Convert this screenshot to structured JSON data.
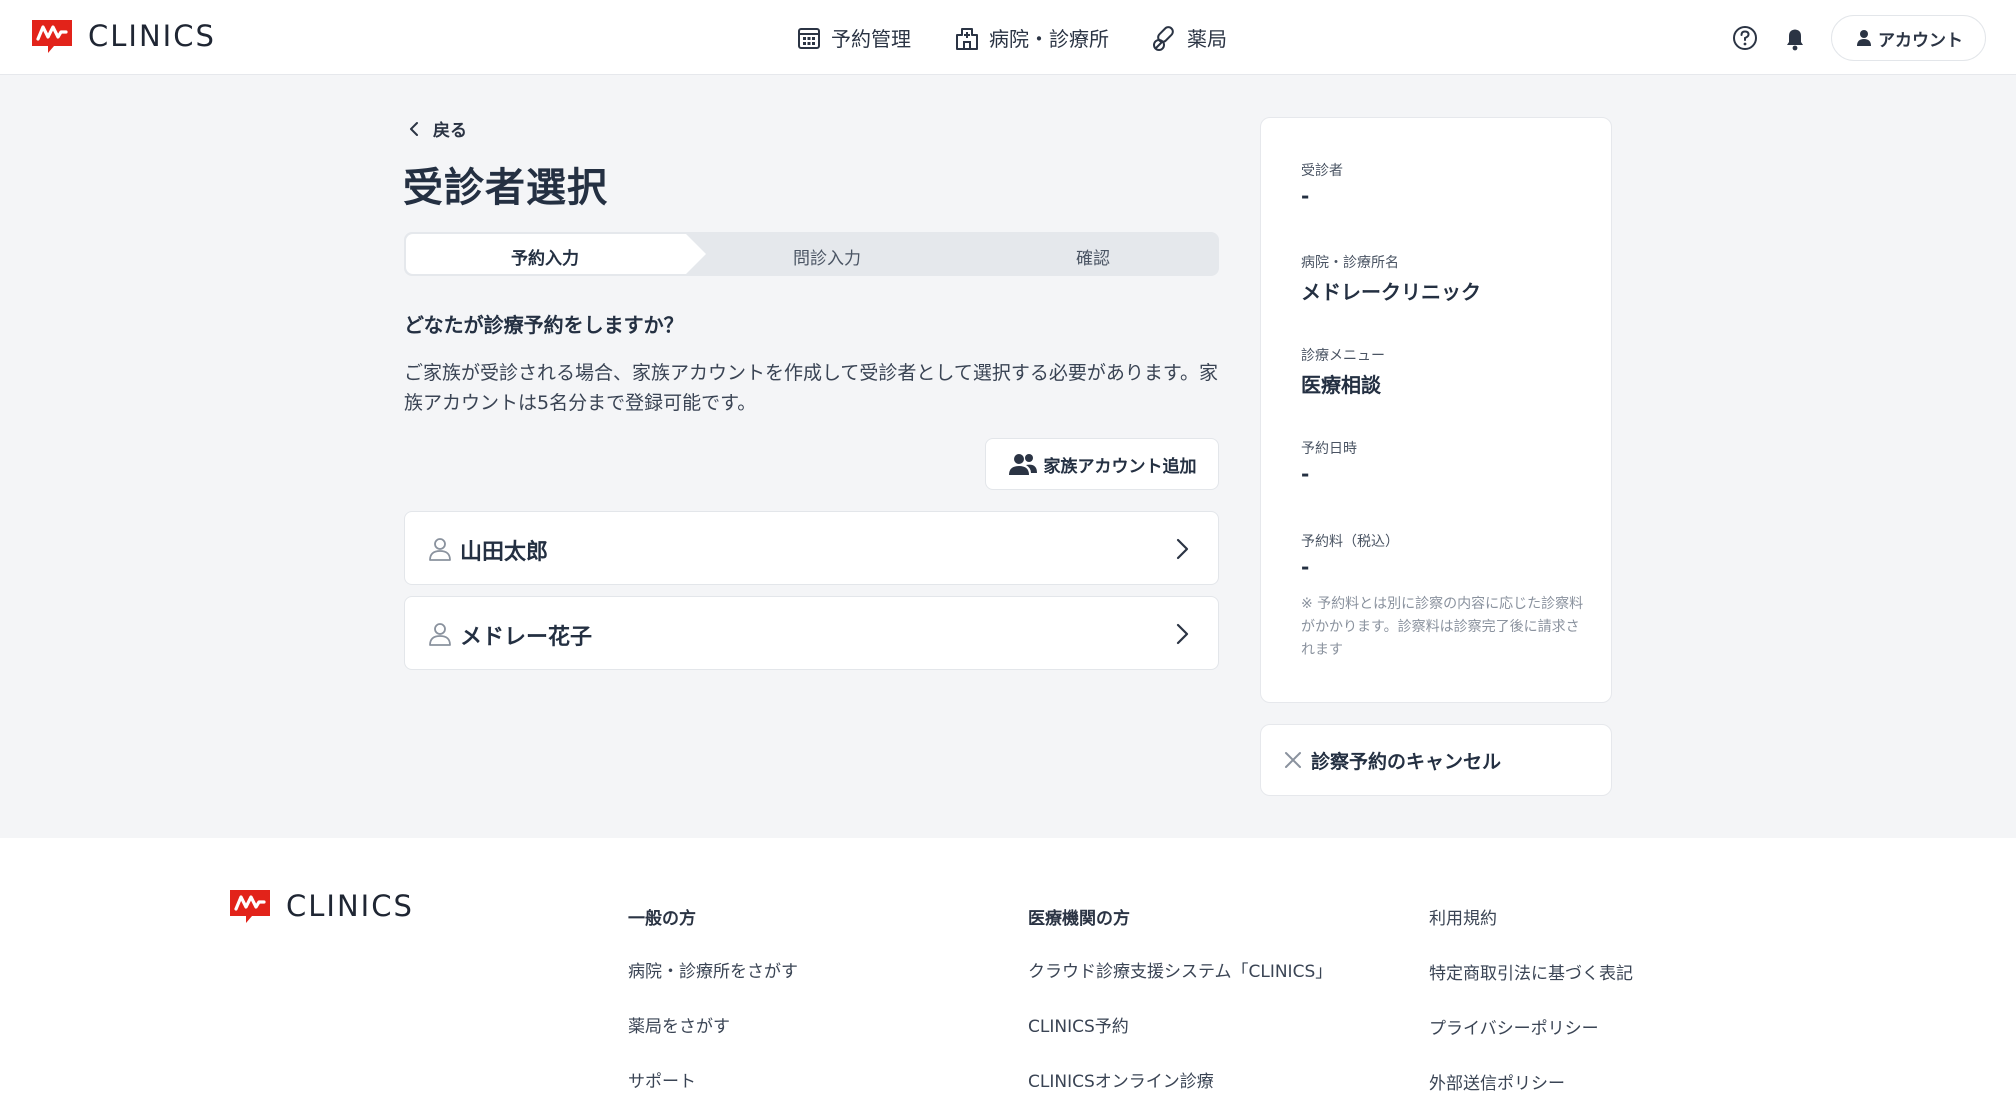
{
  "header": {
    "brand": "CLINICS",
    "nav": [
      {
        "label": "予約管理",
        "icon": "calendar-icon"
      },
      {
        "label": "病院・診療所",
        "icon": "hospital-icon"
      },
      {
        "label": "薬局",
        "icon": "pill-icon"
      }
    ],
    "account_label": "アカウント"
  },
  "main": {
    "back_label": "戻る",
    "title": "受診者選択",
    "steps": [
      "予約入力",
      "問診入力",
      "確認"
    ],
    "question": "どなたが診療予約をしますか？",
    "description": "ご家族が受診される場合、家族アカウントを作成して受診者として選択する必要があります。家族アカウントは5名分まで登録可能です。",
    "add_family_label": "家族アカウント追加",
    "patients": [
      {
        "name": "山田太郎"
      },
      {
        "name": "メドレー花子"
      }
    ]
  },
  "summary": {
    "patient_label": "受診者",
    "patient_value": "-",
    "clinic_label": "病院・診療所名",
    "clinic_value": "メドレークリニック",
    "menu_label": "診療メニュー",
    "menu_value": "医療相談",
    "datetime_label": "予約日時",
    "datetime_value": "-",
    "fee_label": "予約料（税込）",
    "fee_value": "-",
    "note": "※ 予約料とは別に診察の内容に応じた診察料がかかります。診察料は診察完了後に請求されます",
    "cancel_label": "診察予約のキャンセル"
  },
  "footer": {
    "brand": "CLINICS",
    "general_title": "一般の方",
    "general_links": [
      "病院・診療所をさがす",
      "薬局をさがす",
      "サポート"
    ],
    "medical_title": "医療機関の方",
    "medical_links": [
      "クラウド診療支援システム「CLINICS」",
      "CLINICS予約",
      "CLINICSオンライン診療"
    ],
    "legal_links": [
      "利用規約",
      "特定商取引法に基づく表記",
      "プライバシーポリシー",
      "外部送信ポリシー"
    ]
  },
  "colors": {
    "brand_red": "#e2231a",
    "background": "#f4f5f7",
    "text": "#243042"
  }
}
